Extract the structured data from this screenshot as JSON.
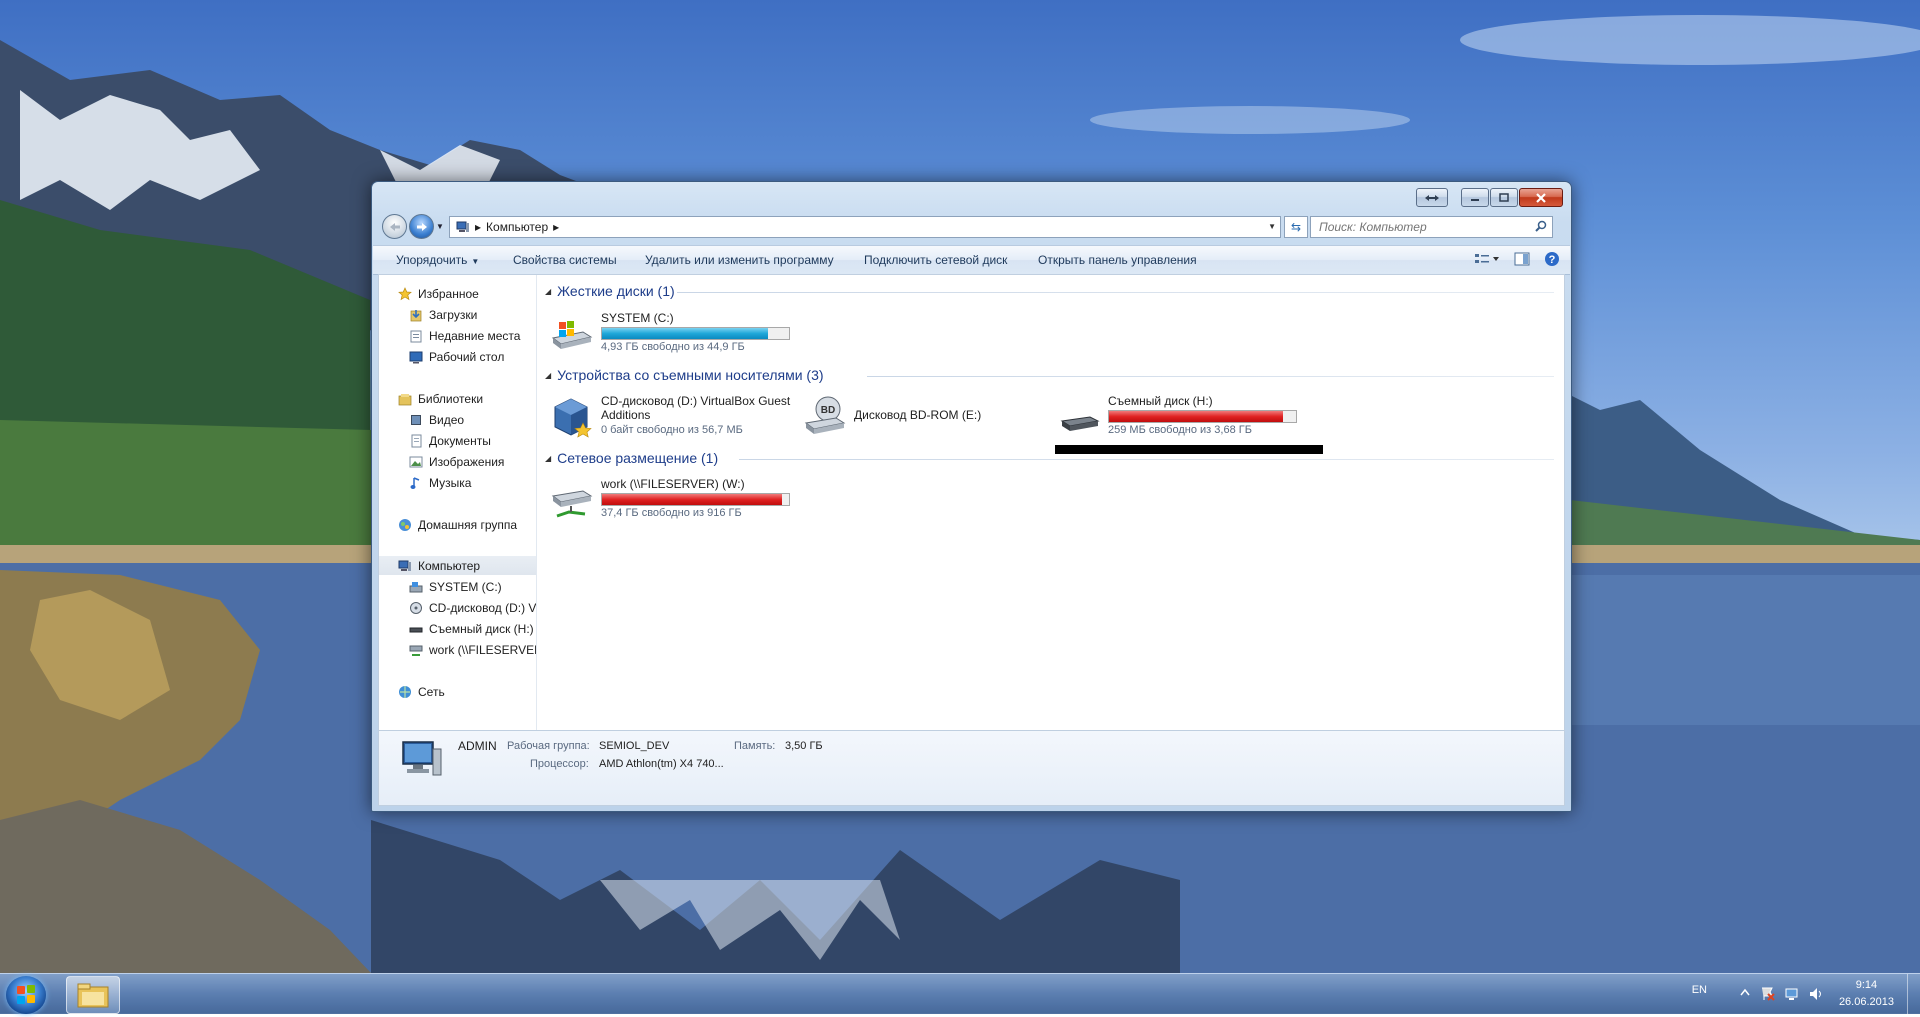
{
  "window": {
    "title": ""
  },
  "address": {
    "path": [
      "Компьютер"
    ],
    "search_placeholder": "Поиск: Компьютер"
  },
  "toolbar": {
    "organize": "Упорядочить",
    "system_properties": "Свойства системы",
    "uninstall": "Удалить или изменить программу",
    "map_drive": "Подключить сетевой диск",
    "control_panel": "Открыть панель управления"
  },
  "nav": {
    "favorites": "Избранное",
    "downloads": "Загрузки",
    "recent": "Недавние места",
    "desktop": "Рабочий стол",
    "libraries": "Библиотеки",
    "video": "Видео",
    "documents": "Документы",
    "pictures": "Изображения",
    "music": "Музыка",
    "homegroup": "Домашняя группа",
    "computer": "Компьютер",
    "drive_c": "SYSTEM (C:)",
    "drive_d": "CD-дисковод (D:) Vi",
    "drive_h": "Съемный диск (H:)",
    "drive_w": "work (\\\\FILESERVER)",
    "network": "Сеть"
  },
  "groups": {
    "hard_disks": "Жесткие диски (1)",
    "removable": "Устройства со съемными носителями (3)",
    "network": "Сетевое размещение (1)"
  },
  "drives": {
    "c": {
      "name": "SYSTEM (C:)",
      "free": "4,93 ГБ свободно из 44,9 ГБ",
      "used_fraction": 0.89
    },
    "d": {
      "name_line1": "CD-дисковод (D:) VirtualBox Guest",
      "name_line2": "Additions",
      "free": "0 байт свободно из 56,7 МБ"
    },
    "e": {
      "name": "Дисковод BD-ROM (E:)"
    },
    "h": {
      "name": "Съемный диск (H:)",
      "free": "259 МБ свободно из 3,68 ГБ",
      "used_fraction": 0.93
    },
    "w": {
      "name": "work (\\\\FILESERVER) (W:)",
      "free": "37,4 ГБ свободно из 916 ГБ",
      "used_fraction": 0.96
    }
  },
  "details": {
    "computer_name": "ADMIN",
    "workgroup_label": "Рабочая группа:",
    "workgroup": "SEMIOL_DEV",
    "memory_label": "Память:",
    "memory": "3,50 ГБ",
    "cpu_label": "Процессор:",
    "cpu": "AMD Athlon(tm) X4 740..."
  },
  "taskbar": {
    "lang": "EN",
    "time": "9:14",
    "date": "26.06.2013"
  },
  "colors": {
    "bar_blue": "#1fa7d9",
    "bar_red": "#e02222",
    "group_heading": "#1e3d8a"
  }
}
